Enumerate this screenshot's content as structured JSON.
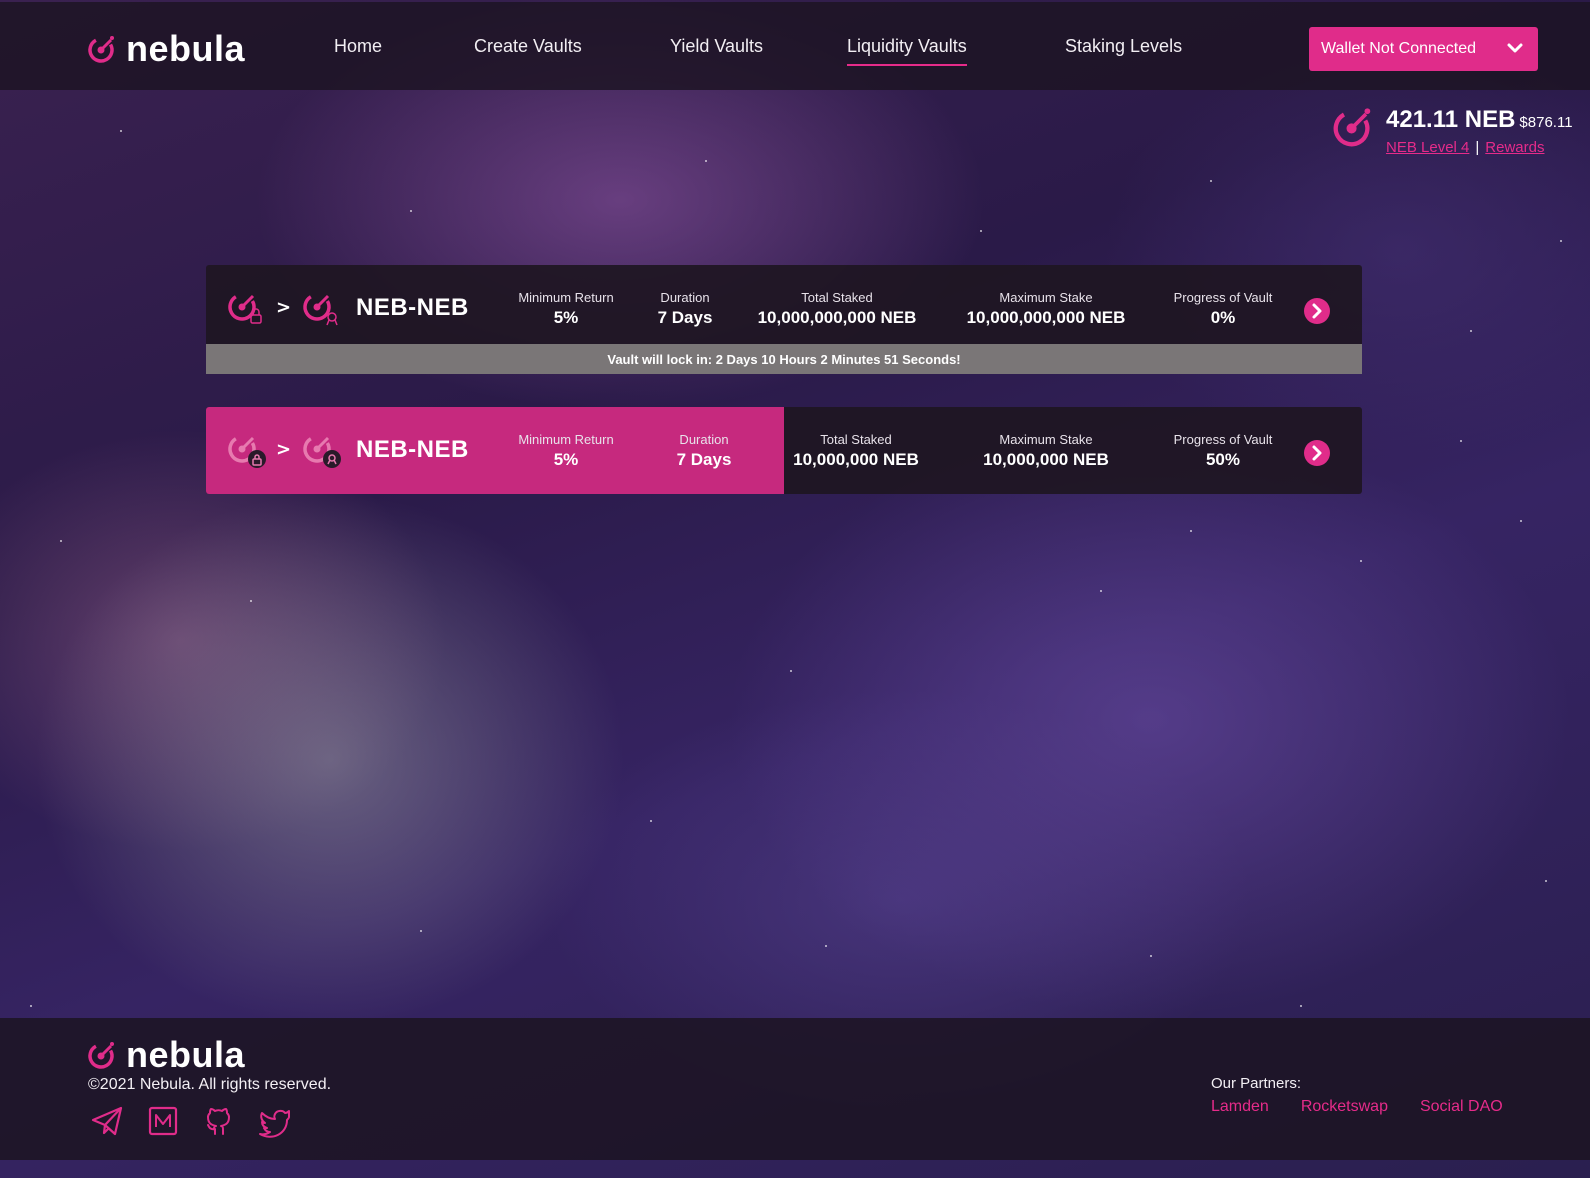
{
  "brand": {
    "name": "nebula",
    "accent": "#e02c8a"
  },
  "nav": {
    "items": [
      {
        "label": "Home"
      },
      {
        "label": "Create Vaults"
      },
      {
        "label": "Yield Vaults"
      },
      {
        "label": "Liquidity Vaults",
        "active": true
      },
      {
        "label": "Staking Levels"
      }
    ],
    "wallet_label": "Wallet Not Connected"
  },
  "balance": {
    "amount": "421.11 NEB",
    "usd": "$876.11",
    "level_link": "NEB Level 4",
    "separator": "|",
    "rewards_link": "Rewards"
  },
  "vaults": [
    {
      "pair": "NEB-NEB",
      "arrow": ">",
      "min_return_label": "Minimum Return",
      "min_return": "5%",
      "duration_label": "Duration",
      "duration": "7 Days",
      "total_staked_label": "Total Staked",
      "total_staked": "10,000,000,000 NEB",
      "max_stake_label": "Maximum Stake",
      "max_stake": "10,000,000,000 NEB",
      "progress_label": "Progress of Vault",
      "progress": "0%",
      "lock_notice": "Vault will lock in: 2 Days 10 Hours 2 Minutes 51 Seconds!"
    },
    {
      "pair": "NEB-NEB",
      "arrow": ">",
      "min_return_label": "Minimum Return",
      "min_return": "5%",
      "duration_label": "Duration",
      "duration": "7 Days",
      "total_staked_label": "Total Staked",
      "total_staked": "10,000,000 NEB",
      "max_stake_label": "Maximum Stake",
      "max_stake": "10,000,000 NEB",
      "progress_label": "Progress of Vault",
      "progress": "50%"
    }
  ],
  "footer": {
    "copyright": "©2021 Nebula. All rights reserved.",
    "socials": [
      "telegram-icon",
      "medium-icon",
      "github-icon",
      "twitter-icon"
    ],
    "partners_title": "Our Partners:",
    "partners": [
      "Lamden",
      "Rocketswap",
      "Social DAO"
    ]
  }
}
